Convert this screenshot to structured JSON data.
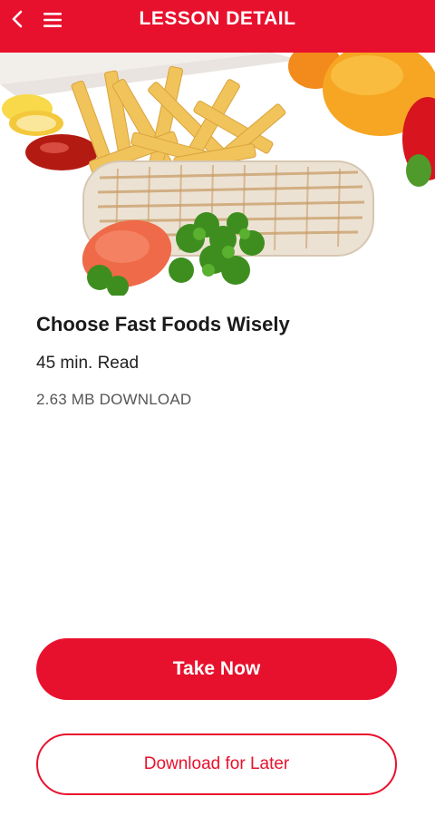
{
  "header": {
    "title": "LESSON DETAIL",
    "back_icon": "chevron-left-icon",
    "menu_icon": "hamburger-menu-icon",
    "background_color": "#e8112d"
  },
  "lesson": {
    "title": "Choose Fast Foods Wisely",
    "duration": "45 min. Read",
    "size": "2.63 MB DOWNLOAD"
  },
  "actions": {
    "take_now": "Take Now",
    "download_later": "Download for Later"
  },
  "colors": {
    "accent": "#e8112d",
    "text": "#1a1a1a",
    "muted": "#555555"
  }
}
